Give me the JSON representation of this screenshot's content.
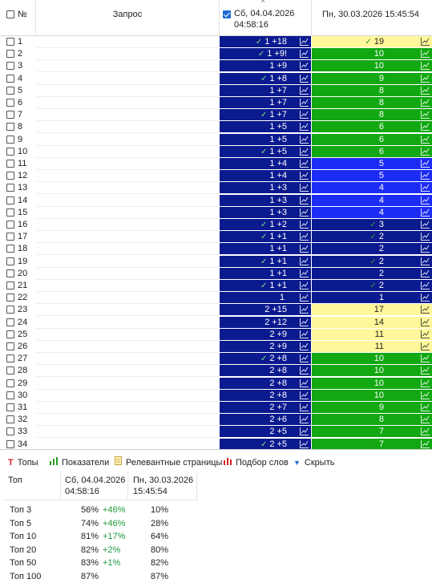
{
  "header": {
    "num_label": "№",
    "query_label": "Запрос",
    "col1_label_line1": "Сб, 04.04.2026",
    "col1_label_line2": "04:58:16",
    "col1_sort_glyph": "^",
    "col2_label": "Пн, 30.03.2026 15:45:54"
  },
  "colors": {
    "navy": "#0b1a8f",
    "blue": "#1d2cf5",
    "green": "#12a812",
    "yellow": "#fff79a"
  },
  "rows": [
    {
      "n": "1",
      "c1": "1",
      "d1": "+18",
      "t1": true,
      "c2": "19",
      "t2": true,
      "bg2": "yellow"
    },
    {
      "n": "2",
      "c1": "1",
      "d1": "+9!",
      "t1": true,
      "c2": "10",
      "t2": false,
      "bg2": "green"
    },
    {
      "n": "3",
      "c1": "1",
      "d1": "+9",
      "t1": false,
      "c2": "10",
      "t2": false,
      "bg2": "green"
    },
    {
      "n": "4",
      "c1": "1",
      "d1": "+8",
      "t1": true,
      "c2": "9",
      "t2": true,
      "bg2": "green"
    },
    {
      "n": "5",
      "c1": "1",
      "d1": "+7",
      "t1": false,
      "c2": "8",
      "t2": false,
      "bg2": "green"
    },
    {
      "n": "6",
      "c1": "1",
      "d1": "+7",
      "t1": false,
      "c2": "8",
      "t2": false,
      "bg2": "green"
    },
    {
      "n": "7",
      "c1": "1",
      "d1": "+7",
      "t1": true,
      "c2": "8",
      "t2": true,
      "bg2": "green"
    },
    {
      "n": "8",
      "c1": "1",
      "d1": "+5",
      "t1": false,
      "c2": "6",
      "t2": false,
      "bg2": "green"
    },
    {
      "n": "9",
      "c1": "1",
      "d1": "+5",
      "t1": false,
      "c2": "6",
      "t2": false,
      "bg2": "green"
    },
    {
      "n": "10",
      "c1": "1",
      "d1": "+5",
      "t1": true,
      "c2": "6",
      "t2": true,
      "bg2": "green"
    },
    {
      "n": "11",
      "c1": "1",
      "d1": "+4",
      "t1": false,
      "c2": "5",
      "t2": false,
      "bg2": "blue"
    },
    {
      "n": "12",
      "c1": "1",
      "d1": "+4",
      "t1": false,
      "c2": "5",
      "t2": false,
      "bg2": "blue"
    },
    {
      "n": "13",
      "c1": "1",
      "d1": "+3",
      "t1": false,
      "c2": "4",
      "t2": false,
      "bg2": "blue"
    },
    {
      "n": "14",
      "c1": "1",
      "d1": "+3",
      "t1": false,
      "c2": "4",
      "t2": false,
      "bg2": "blue"
    },
    {
      "n": "15",
      "c1": "1",
      "d1": "+3",
      "t1": false,
      "c2": "4",
      "t2": false,
      "bg2": "blue"
    },
    {
      "n": "16",
      "c1": "1",
      "d1": "+2",
      "t1": true,
      "c2": "3",
      "t2": true,
      "bg2": "navy"
    },
    {
      "n": "17",
      "c1": "1",
      "d1": "+1",
      "t1": true,
      "c2": "2",
      "t2": true,
      "bg2": "navy"
    },
    {
      "n": "18",
      "c1": "1",
      "d1": "+1",
      "t1": false,
      "c2": "2",
      "t2": false,
      "bg2": "navy"
    },
    {
      "n": "19",
      "c1": "1",
      "d1": "+1",
      "t1": true,
      "c2": "2",
      "t2": true,
      "bg2": "navy"
    },
    {
      "n": "20",
      "c1": "1",
      "d1": "+1",
      "t1": false,
      "c2": "2",
      "t2": false,
      "bg2": "navy"
    },
    {
      "n": "21",
      "c1": "1",
      "d1": "+1",
      "t1": true,
      "c2": "2",
      "t2": true,
      "bg2": "navy"
    },
    {
      "n": "22",
      "c1": "1",
      "d1": "",
      "t1": false,
      "c2": "1",
      "t2": false,
      "bg2": "navy"
    },
    {
      "n": "23",
      "c1": "2",
      "d1": "+15",
      "t1": false,
      "c2": "17",
      "t2": false,
      "bg2": "yellow"
    },
    {
      "n": "24",
      "c1": "2",
      "d1": "+12",
      "t1": false,
      "c2": "14",
      "t2": false,
      "bg2": "yellow"
    },
    {
      "n": "25",
      "c1": "2",
      "d1": "+9",
      "t1": false,
      "c2": "11",
      "t2": false,
      "bg2": "yellow"
    },
    {
      "n": "26",
      "c1": "2",
      "d1": "+9",
      "t1": false,
      "c2": "11",
      "t2": false,
      "bg2": "yellow"
    },
    {
      "n": "27",
      "c1": "2",
      "d1": "+8",
      "t1": true,
      "c2": "10",
      "t2": true,
      "bg2": "green"
    },
    {
      "n": "28",
      "c1": "2",
      "d1": "+8",
      "t1": false,
      "c2": "10",
      "t2": false,
      "bg2": "green"
    },
    {
      "n": "29",
      "c1": "2",
      "d1": "+8",
      "t1": false,
      "c2": "10",
      "t2": false,
      "bg2": "green"
    },
    {
      "n": "30",
      "c1": "2",
      "d1": "+8",
      "t1": false,
      "c2": "10",
      "t2": false,
      "bg2": "green"
    },
    {
      "n": "31",
      "c1": "2",
      "d1": "+7",
      "t1": false,
      "c2": "9",
      "t2": false,
      "bg2": "green"
    },
    {
      "n": "32",
      "c1": "2",
      "d1": "+6",
      "t1": false,
      "c2": "8",
      "t2": false,
      "bg2": "green"
    },
    {
      "n": "33",
      "c1": "2",
      "d1": "+5",
      "t1": false,
      "c2": "7",
      "t2": false,
      "bg2": "green"
    },
    {
      "n": "34",
      "c1": "2",
      "d1": "+5",
      "t1": true,
      "c2": "7",
      "t2": true,
      "bg2": "green"
    }
  ],
  "bottom_tabs": [
    {
      "label": "Топы",
      "icon": "top-icon"
    },
    {
      "label": "Показатели",
      "icon": "bar-chart-icon"
    },
    {
      "label": "Релевантные страницы",
      "icon": "document-icon"
    },
    {
      "label": "Подбор слов",
      "icon": "bar-chart-red-icon"
    },
    {
      "label": "Скрыть",
      "icon": "chevron-down-icon"
    }
  ],
  "stats": {
    "col0_label": "Топ",
    "col1_line1": "Сб, 04.04.2026",
    "col1_line2": "04:58:16",
    "col2_line1": "Пн, 30.03.2026",
    "col2_line2": "15:45:54",
    "rows": [
      {
        "name": "Топ 3",
        "v1": "56%",
        "d1": "+46%",
        "v2": "10%"
      },
      {
        "name": "Топ 5",
        "v1": "74%",
        "d1": "+46%",
        "v2": "28%"
      },
      {
        "name": "Топ 10",
        "v1": "81%",
        "d1": "+17%",
        "v2": "64%"
      },
      {
        "name": "Топ 20",
        "v1": "82%",
        "d1": "+2%",
        "v2": "80%"
      },
      {
        "name": "Топ 50",
        "v1": "83%",
        "d1": "+1%",
        "v2": "82%"
      },
      {
        "name": "Топ 100",
        "v1": "87%",
        "d1": "",
        "v2": "87%"
      }
    ]
  }
}
